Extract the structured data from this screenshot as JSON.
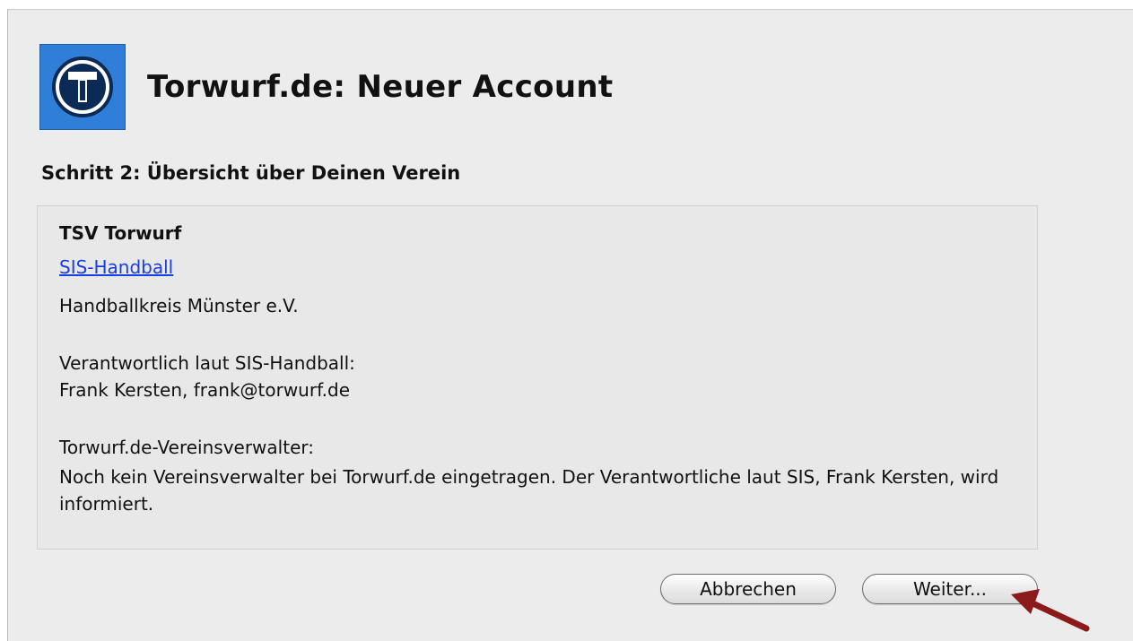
{
  "dialog": {
    "title": "Torwurf.de: Neuer Account",
    "step": "Schritt 2: Übersicht über Deinen Verein",
    "icon": "torwurf-logo-icon"
  },
  "club": {
    "name": "TSV Torwurf",
    "link": "SIS-Handball",
    "association": "Handballkreis Münster e.V.",
    "responsible_label": "Verantwortlich laut SIS-Handball:",
    "responsible_value": "Frank Kersten, frank@torwurf.de",
    "admin_label": "Torwurf.de-Vereinsverwalter:",
    "admin_text": "Noch kein Vereinsverwalter bei Torwurf.de eingetragen. Der Verantwortliche laut SIS, Frank Kersten, wird informiert."
  },
  "buttons": {
    "cancel": "Abbrechen",
    "next": "Weiter..."
  },
  "colors": {
    "accent": "#2f7fd8",
    "link": "#1a3ee0",
    "arrow": "#8b1a1a"
  }
}
